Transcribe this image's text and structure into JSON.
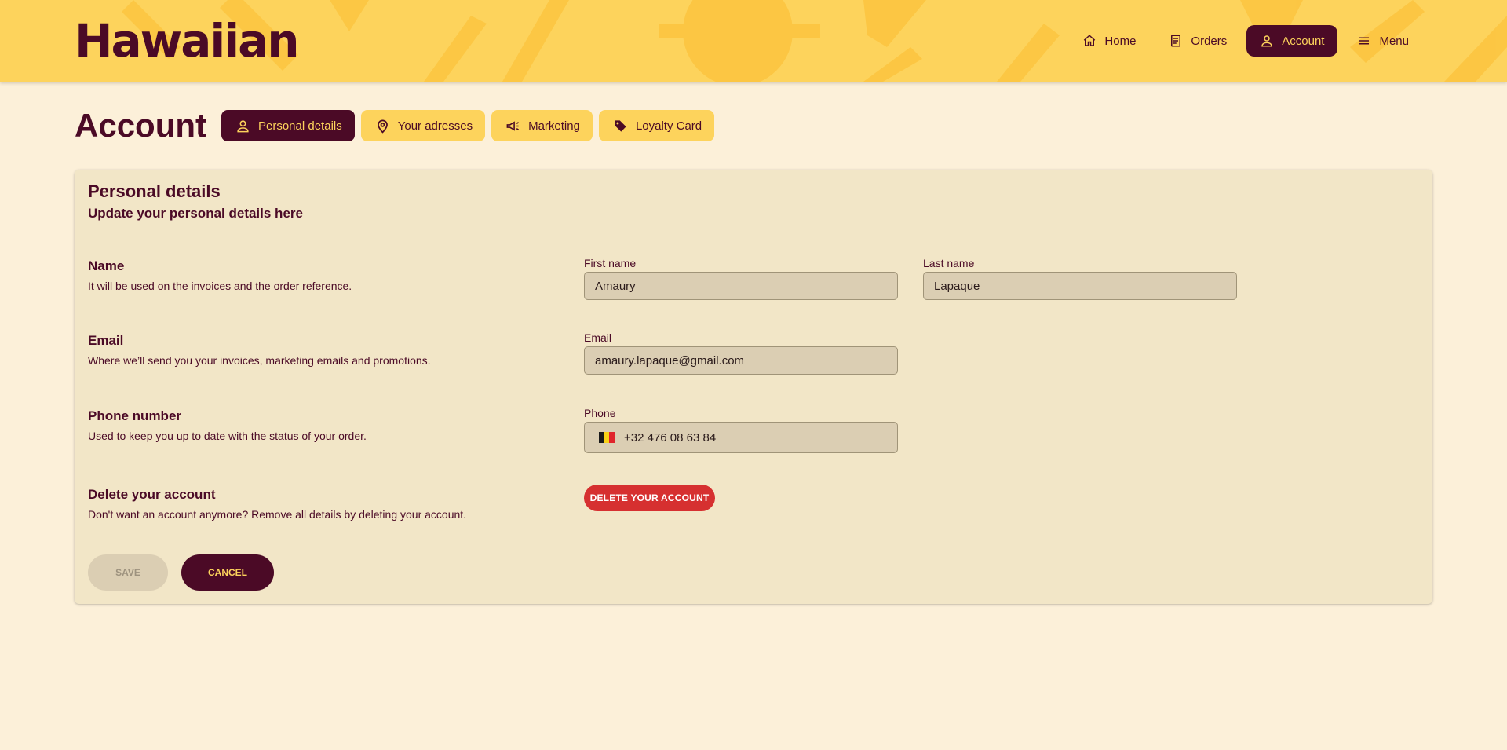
{
  "header": {
    "logo_text": "Hawaiian",
    "nav": [
      {
        "label": "Home",
        "icon": "home-icon"
      },
      {
        "label": "Orders",
        "icon": "receipt-icon"
      },
      {
        "label": "Account",
        "icon": "user-icon",
        "active": true
      },
      {
        "label": "Menu",
        "icon": "hamburger-icon"
      }
    ]
  },
  "page": {
    "title": "Account",
    "tabs": [
      {
        "label": "Personal details",
        "icon": "user-icon",
        "active": true
      },
      {
        "label": "Your adresses",
        "icon": "map-pin-icon"
      },
      {
        "label": "Marketing",
        "icon": "megaphone-icon"
      },
      {
        "label": "Loyalty Card",
        "icon": "tag-icon"
      }
    ]
  },
  "card": {
    "title": "Personal details",
    "subtitle": "Update your personal details here",
    "name": {
      "label": "Name",
      "description": "It will be used on the invoices and the order reference.",
      "first_name_label": "First name",
      "first_name_value": "Amaury",
      "last_name_label": "Last name",
      "last_name_value": "Lapaque"
    },
    "email": {
      "label": "Email",
      "description": "Where we’ll send you your invoices, marketing emails and promotions.",
      "field_label": "Email",
      "value": "amaury.lapaque@gmail.com"
    },
    "phone": {
      "label": "Phone number",
      "description": "Used to keep you up to date with the status of your order.",
      "field_label": "Phone",
      "value": "+32 476 08 63 84",
      "country_flag": "belgium-flag-icon"
    },
    "delete": {
      "label": "Delete your account",
      "description": "Don't want an account anymore? Remove all details by deleting your account.",
      "button_label": "DELETE YOUR ACCOUNT"
    },
    "actions": {
      "save_label": "SAVE",
      "cancel_label": "CANCEL"
    }
  },
  "colors": {
    "brand_dark": "#4b0a26",
    "brand_yellow": "#fdd35c",
    "background": "#fcf0d9",
    "card": "#f2e6c7",
    "danger": "#d63030"
  }
}
